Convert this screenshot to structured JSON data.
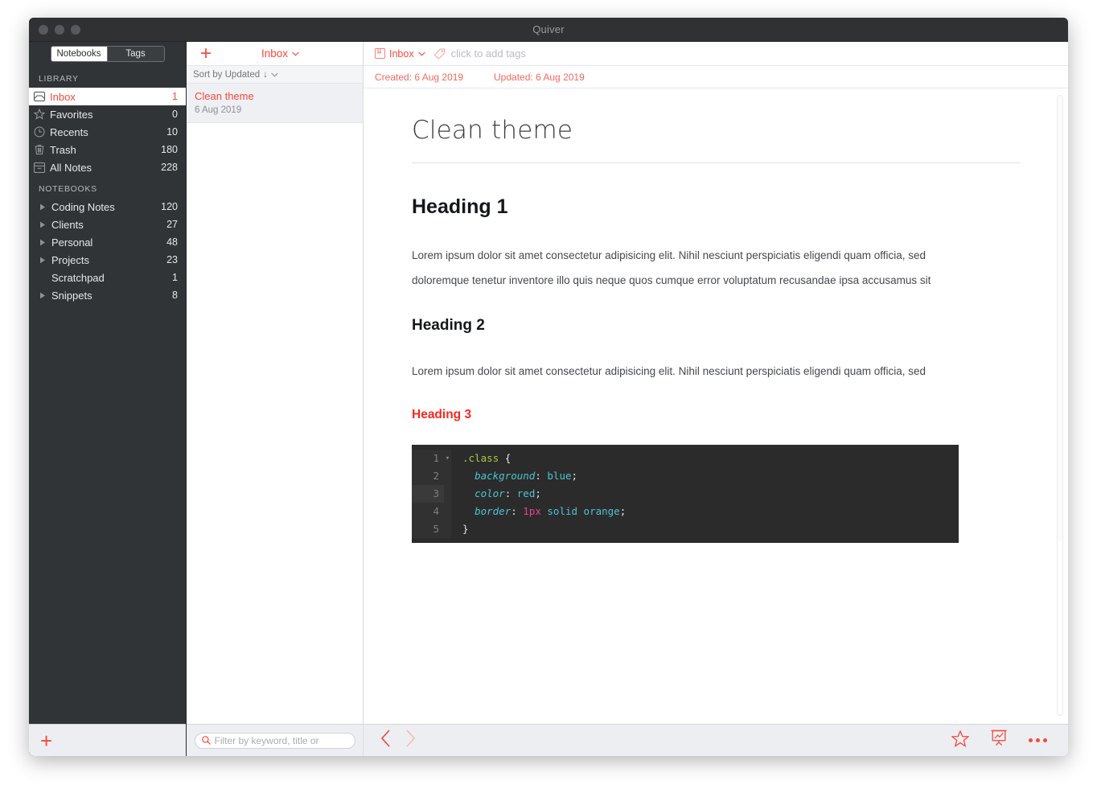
{
  "window": {
    "title": "Quiver",
    "traffic_lights": [
      "close",
      "minimize",
      "zoom"
    ]
  },
  "sidebar": {
    "tabs": [
      {
        "label": "Notebooks",
        "active": true
      },
      {
        "label": "Tags",
        "active": false
      }
    ],
    "library_header": "LIBRARY",
    "library_items": [
      {
        "label": "Inbox",
        "count": "1",
        "icon": "inbox-icon",
        "selected": true
      },
      {
        "label": "Favorites",
        "count": "0",
        "icon": "star-icon",
        "selected": false
      },
      {
        "label": "Recents",
        "count": "10",
        "icon": "clock-icon",
        "selected": false
      },
      {
        "label": "Trash",
        "count": "180",
        "icon": "trash-icon",
        "selected": false
      },
      {
        "label": "All Notes",
        "count": "228",
        "icon": "archive-icon",
        "selected": false
      }
    ],
    "notebooks_header": "NOTEBOOKS",
    "notebooks": [
      {
        "label": "Coding Notes",
        "count": "120",
        "expandable": true
      },
      {
        "label": "Clients",
        "count": "27",
        "expandable": true
      },
      {
        "label": "Personal",
        "count": "48",
        "expandable": true
      },
      {
        "label": "Projects",
        "count": "23",
        "expandable": true
      },
      {
        "label": "Scratchpad",
        "count": "1",
        "expandable": false
      },
      {
        "label": "Snippets",
        "count": "8",
        "expandable": true
      }
    ],
    "footer": {
      "add_label": "+"
    }
  },
  "notelist": {
    "add_label": "+",
    "notebook_selector": "Inbox",
    "sort_label": "Sort by Updated",
    "sort_direction": "↓",
    "notes": [
      {
        "title": "Clean theme",
        "date": "6 Aug 2019",
        "selected": true
      }
    ],
    "search": {
      "placeholder": "Filter by keyword, title or",
      "value": ""
    }
  },
  "editor": {
    "notebook": "Inbox",
    "tags_placeholder": "click to add tags",
    "created": "Created: 6 Aug 2019",
    "updated": "Updated: 6 Aug 2019",
    "note": {
      "title": "Clean theme",
      "blocks": [
        {
          "type": "h1",
          "text": "Heading 1"
        },
        {
          "type": "p",
          "text": "Lorem ipsum dolor sit amet consectetur adipisicing elit. Nihil nesciunt perspiciatis eligendi quam officia, sed doloremque tenetur inventore illo quis neque quos cumque error voluptatum recusandae ipsa accusamus sit"
        },
        {
          "type": "h2",
          "text": "Heading 2"
        },
        {
          "type": "p",
          "text": "Lorem ipsum dolor sit amet consectetur adipisicing elit. Nihil nesciunt perspiciatis eligendi quam officia, sed"
        },
        {
          "type": "h3",
          "text": "Heading 3"
        }
      ],
      "code": {
        "language": "css",
        "lines": [
          {
            "num": "1",
            "foldable": true,
            "highlight": false,
            "text": ".class {"
          },
          {
            "num": "2",
            "foldable": false,
            "highlight": false,
            "text": "  background: blue;"
          },
          {
            "num": "3",
            "foldable": false,
            "highlight": true,
            "text": "  color: red;"
          },
          {
            "num": "4",
            "foldable": false,
            "highlight": false,
            "text": "  border: 1px solid orange;"
          },
          {
            "num": "5",
            "foldable": false,
            "highlight": false,
            "text": "}"
          }
        ]
      }
    },
    "footer": {
      "back": "‹",
      "forward": "›",
      "icons": [
        "star-icon",
        "presentation-icon",
        "more-icon"
      ]
    }
  },
  "colors": {
    "accent_red": "#f8483e",
    "heading3_red": "#f8281e",
    "sidebar_bg": "#313437",
    "titlebar_bg": "#2f3133",
    "code_bg": "#2b2b2b",
    "code_gutter_bg": "#313131",
    "code_selector": "#a6c942",
    "code_property": "#4ec3d4",
    "code_number": "#e9438f"
  }
}
